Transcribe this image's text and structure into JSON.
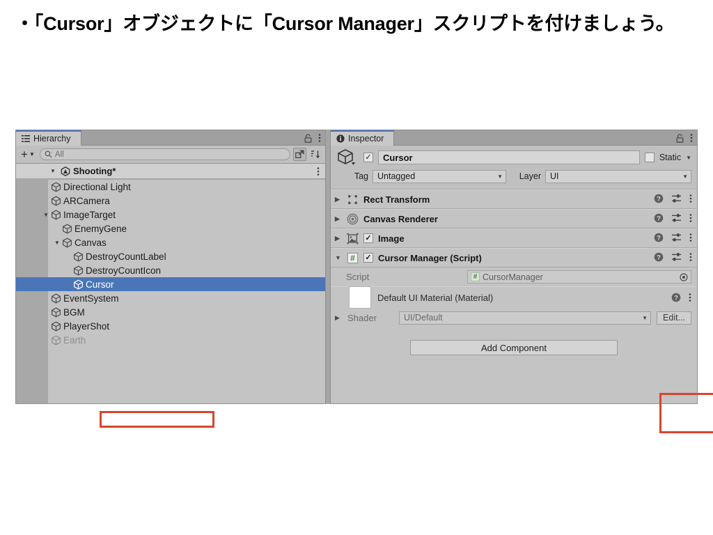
{
  "slide": {
    "heading": "・「Cursor」オブジェクトに「Cursor Manager」スクリプトを付けましょう。"
  },
  "colors": {
    "selection_blue": "#4a76b8",
    "annotation_red": "#d9442e",
    "panel_bg": "#c4c4c4",
    "tab_bg": "#a0a0a0"
  },
  "hierarchy": {
    "tab_label": "Hierarchy",
    "tab_icon": "hierarchy-icon",
    "lock_icon": "lock-icon",
    "menu_icon": "kebab-menu-icon",
    "toolbar": {
      "add_label": "+",
      "add_dropdown_icon": "chevron-down-icon",
      "search_icon": "search-icon",
      "search_value": "All",
      "search_placeholder": "All",
      "open_window_icon": "open-in-window-icon",
      "sort_icon": "sort-icon"
    },
    "scene": {
      "label": "Shooting*",
      "icon": "unity-logo-icon",
      "foldout": "▼",
      "menu_icon": "kebab-menu-icon"
    },
    "items": [
      {
        "label": "Directional Light",
        "depth": 2,
        "foldout": "",
        "selected": false,
        "dim": false
      },
      {
        "label": "ARCamera",
        "depth": 2,
        "foldout": "",
        "selected": false,
        "dim": false
      },
      {
        "label": "ImageTarget",
        "depth": 2,
        "foldout": "▼",
        "selected": false,
        "dim": false
      },
      {
        "label": "EnemyGene",
        "depth": 3,
        "foldout": "",
        "selected": false,
        "dim": false
      },
      {
        "label": "Canvas",
        "depth": 3,
        "foldout": "▼",
        "selected": false,
        "dim": false
      },
      {
        "label": "DestroyCountLabel",
        "depth": 4,
        "foldout": "",
        "selected": false,
        "dim": false
      },
      {
        "label": "DestroyCountIcon",
        "depth": 4,
        "foldout": "",
        "selected": false,
        "dim": false
      },
      {
        "label": "Cursor",
        "depth": 4,
        "foldout": "",
        "selected": true,
        "dim": false
      },
      {
        "label": "EventSystem",
        "depth": 2,
        "foldout": "",
        "selected": false,
        "dim": false
      },
      {
        "label": "BGM",
        "depth": 2,
        "foldout": "",
        "selected": false,
        "dim": false
      },
      {
        "label": "PlayerShot",
        "depth": 2,
        "foldout": "",
        "selected": false,
        "dim": false
      },
      {
        "label": "Earth",
        "depth": 2,
        "foldout": "",
        "selected": false,
        "dim": true
      }
    ]
  },
  "inspector": {
    "tab_label": "Inspector",
    "tab_icon": "info-icon",
    "lock_icon": "lock-icon",
    "menu_icon": "kebab-menu-icon",
    "object": {
      "icon": "gameobject-cube-icon",
      "enabled": true,
      "name": "Cursor",
      "static_label": "Static",
      "static_checked": false,
      "static_dropdown_icon": "chevron-down-icon",
      "tag_label": "Tag",
      "tag_value": "Untagged",
      "layer_label": "Layer",
      "layer_value": "UI"
    },
    "components": [
      {
        "name": "Rect Transform",
        "icon": "rect-transform-icon",
        "foldout": "▶",
        "has_checkbox": false,
        "checked": false
      },
      {
        "name": "Canvas Renderer",
        "icon": "canvas-renderer-icon",
        "foldout": "▶",
        "has_checkbox": false,
        "checked": false
      },
      {
        "name": "Image",
        "icon": "image-component-icon",
        "foldout": "▶",
        "has_checkbox": true,
        "checked": true
      },
      {
        "name": "Cursor Manager (Script)",
        "icon": "csharp-script-icon",
        "foldout": "▼",
        "has_checkbox": true,
        "checked": true
      }
    ],
    "component_icons": {
      "help": "help-icon",
      "preset": "preset-icon",
      "menu": "kebab-menu-icon"
    },
    "script_property": {
      "label": "Script",
      "value": "CursorManager",
      "badge": "csharp-badge-icon",
      "picker_icon": "object-picker-icon"
    },
    "material": {
      "title": "Default UI Material (Material)",
      "swatch_icon": "material-preview-swatch",
      "help_icon": "help-icon",
      "menu_icon": "kebab-menu-icon",
      "foldout": "▶",
      "shader_label": "Shader",
      "shader_value": "UI/Default",
      "shader_dropdown_icon": "chevron-down-icon",
      "edit_label": "Edit..."
    },
    "add_component_label": "Add Component"
  }
}
